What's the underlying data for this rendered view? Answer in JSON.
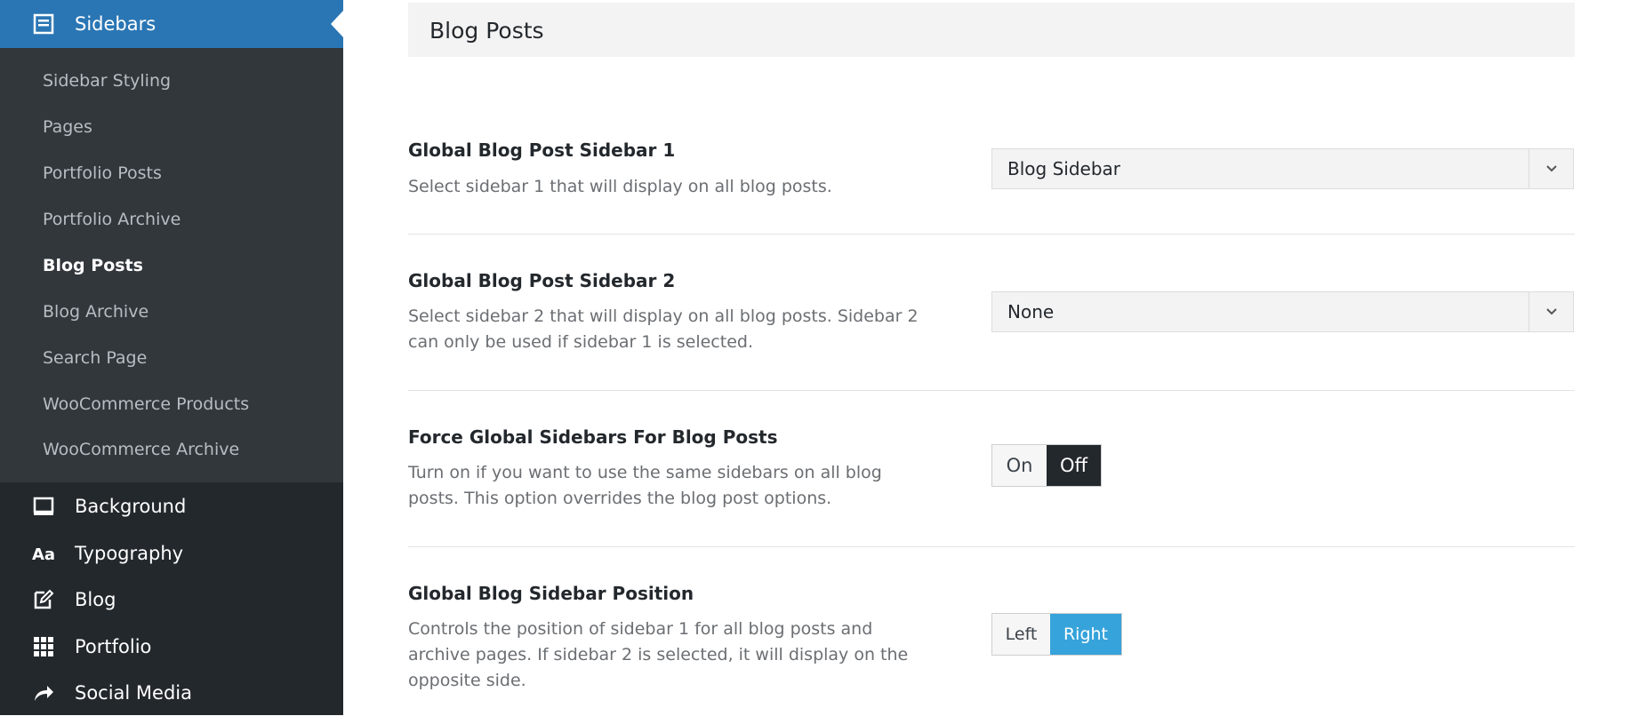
{
  "sidebar": {
    "active": {
      "label": "Sidebars",
      "icon": "sidebars-icon"
    },
    "submenu": [
      {
        "label": "Sidebar Styling",
        "current": false
      },
      {
        "label": "Pages",
        "current": false
      },
      {
        "label": "Portfolio Posts",
        "current": false
      },
      {
        "label": "Portfolio Archive",
        "current": false
      },
      {
        "label": "Blog Posts",
        "current": true
      },
      {
        "label": "Blog Archive",
        "current": false
      },
      {
        "label": "Search Page",
        "current": false
      },
      {
        "label": "WooCommerce Products",
        "current": false
      },
      {
        "label": "WooCommerce Archive",
        "current": false
      }
    ],
    "menu": [
      {
        "label": "Background",
        "icon": "monitor-icon"
      },
      {
        "label": "Typography",
        "icon": "typography-icon"
      },
      {
        "label": "Blog",
        "icon": "edit-icon"
      },
      {
        "label": "Portfolio",
        "icon": "grid-icon"
      },
      {
        "label": "Social Media",
        "icon": "share-arrow-icon"
      }
    ]
  },
  "main": {
    "section_title": "Blog Posts",
    "options": [
      {
        "title": "Global Blog Post Sidebar 1",
        "desc": "Select sidebar 1 that will display on all blog posts.",
        "control": "select",
        "value": "Blog Sidebar"
      },
      {
        "title": "Global Blog Post Sidebar 2",
        "desc": "Select sidebar 2 that will display on all blog posts. Sidebar 2 can only be used if sidebar 1 is selected.",
        "control": "select",
        "value": "None"
      },
      {
        "title": "Force Global Sidebars For Blog Posts",
        "desc": "Turn on if you want to use the same sidebars on all blog posts. This option overrides the blog post options.",
        "control": "toggle",
        "choices": [
          "On",
          "Off"
        ],
        "selected": "Off"
      },
      {
        "title": "Global Blog Sidebar Position",
        "desc": "Controls the position of sidebar 1 for all blog posts and archive pages. If sidebar 2 is selected, it will display on the opposite side.",
        "control": "toggle",
        "choices": [
          "Left",
          "Right"
        ],
        "selected": "Right"
      }
    ]
  },
  "colors": {
    "sidebar_bg": "#23282d",
    "submenu_bg": "#32373c",
    "active_blue": "#2a76b4",
    "toggle_dark": "#23282d",
    "toggle_blue": "#36a3db"
  }
}
